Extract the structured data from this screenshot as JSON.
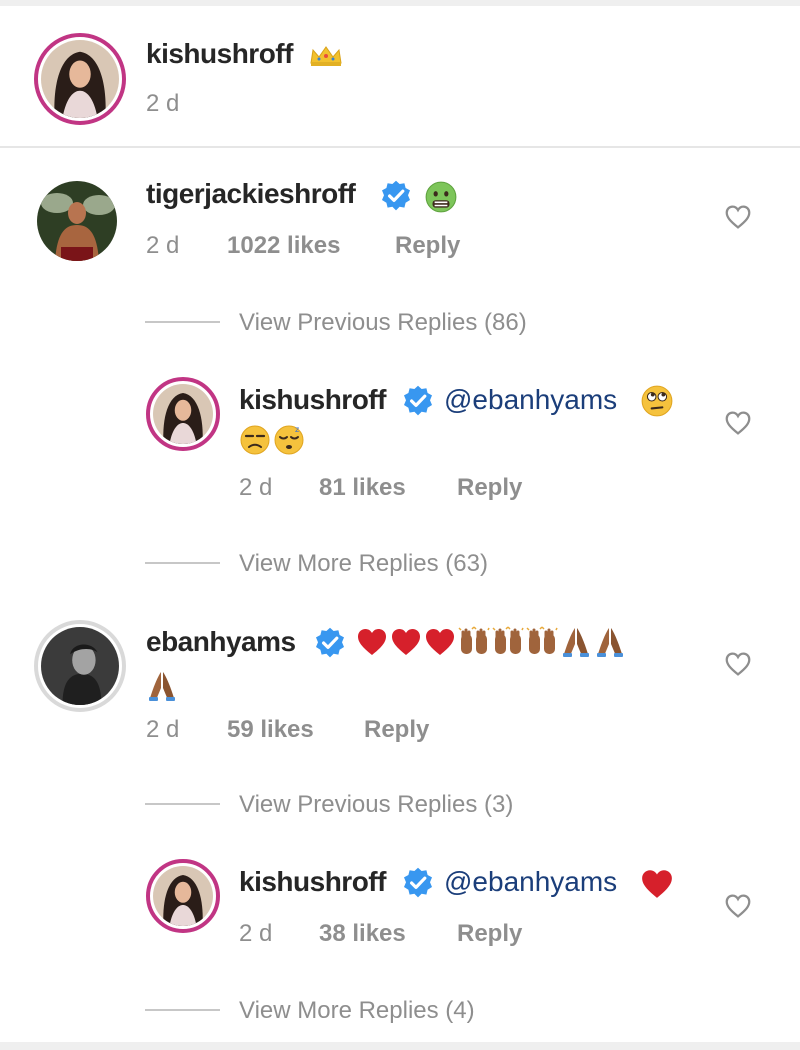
{
  "post": {
    "username": "kishushroff",
    "username_icon": "crown-emoji",
    "time": "2 d"
  },
  "comments": [
    {
      "username": "tigerjackieshroff",
      "verified": true,
      "emoji": [
        "nauseated-face-emoji"
      ],
      "time": "2 d",
      "likes": "1022 likes",
      "reply_label": "Reply",
      "view_previous": "View Previous Replies (86)",
      "reply": {
        "username": "kishushroff",
        "verified": true,
        "mention": "@ebanhyams",
        "emoji": [
          "eye-roll-emoji",
          "unamused-face-emoji",
          "sleepy-face-emoji"
        ],
        "time": "2 d",
        "likes": "81 likes",
        "reply_label": "Reply"
      },
      "view_more": "View More Replies (63)"
    },
    {
      "username": "ebanhyams",
      "verified": true,
      "emoji": [
        "red-heart-emoji",
        "red-heart-emoji",
        "red-heart-emoji",
        "raised-hands-emoji",
        "raised-hands-emoji",
        "raised-hands-emoji",
        "folded-hands-emoji",
        "folded-hands-emoji",
        "folded-hands-emoji"
      ],
      "time": "2 d",
      "likes": "59 likes",
      "reply_label": "Reply",
      "view_previous": "View Previous Replies (3)",
      "reply": {
        "username": "kishushroff",
        "verified": true,
        "mention": "@ebanhyams",
        "emoji": [
          "red-heart-emoji"
        ],
        "time": "2 d",
        "likes": "38 likes",
        "reply_label": "Reply"
      },
      "view_more": "View More Replies (4)"
    }
  ],
  "colors": {
    "verified_badge": "#3897f0",
    "story_ring": "#c13584",
    "mention": "#1b3e7a",
    "muted_text": "#8e8e8e"
  }
}
